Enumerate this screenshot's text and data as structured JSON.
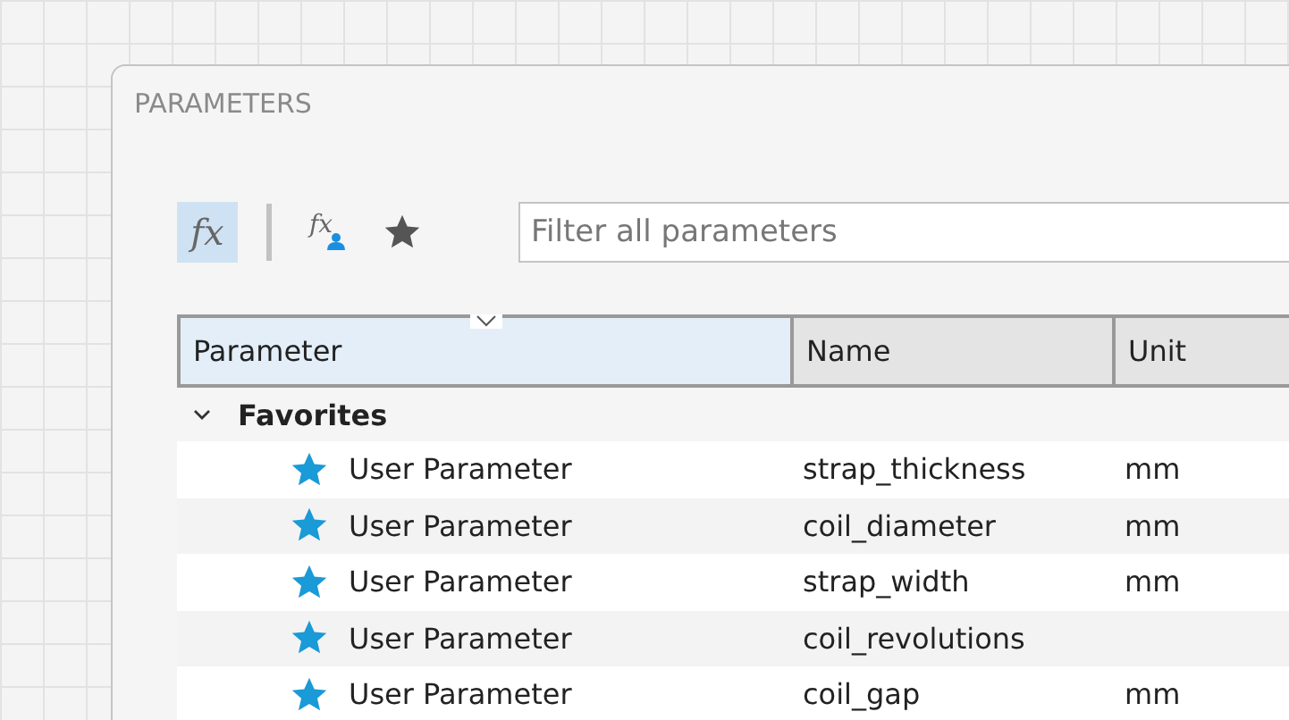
{
  "window": {
    "title": "PARAMETERS"
  },
  "toolbar": [
    {
      "kind": "all",
      "glyph": "fx",
      "selected": true
    },
    {
      "kind": "user",
      "glyph": "fx",
      "selected": false
    },
    {
      "kind": "favorites",
      "selected": false
    }
  ],
  "search": {
    "placeholder": "Filter all parameters"
  },
  "table": {
    "columns": [
      {
        "label": "Parameter",
        "selected": true
      },
      {
        "label": "Name",
        "selected": false
      },
      {
        "label": "Unit",
        "selected": false
      }
    ],
    "groups": [
      {
        "label": "Favorites",
        "expanded": true,
        "rows": [
          {
            "parameter": "User Parameter",
            "name": "strap_thickness",
            "unit": "mm",
            "favorite": true
          },
          {
            "parameter": "User Parameter",
            "name": "coil_diameter",
            "unit": "mm",
            "favorite": true
          },
          {
            "parameter": "User Parameter",
            "name": "strap_width",
            "unit": "mm",
            "favorite": true
          },
          {
            "parameter": "User Parameter",
            "name": "coil_revolutions",
            "favorite": true
          },
          {
            "parameter": "User Parameter",
            "name": "coil_gap",
            "unit": "mm",
            "favorite": true
          }
        ]
      }
    ]
  }
}
